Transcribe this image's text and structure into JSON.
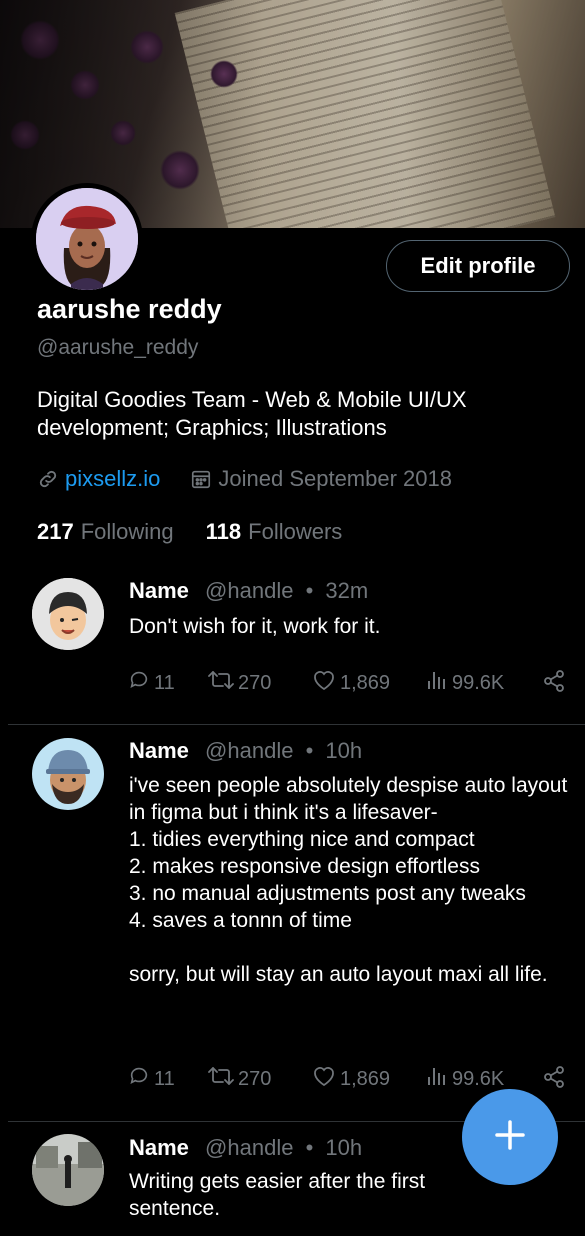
{
  "profile": {
    "name": "aarushe reddy",
    "handle": "@aarushe_reddy",
    "bio": "Digital Goodies Team - Web & Mobile UI/UX development; Graphics; Illustrations",
    "website": "pixsellz.io",
    "joined": "Joined September 2018",
    "following_count": "217",
    "following_label": "Following",
    "followers_count": "118",
    "followers_label": "Followers",
    "edit_label": "Edit profile"
  },
  "tweets": [
    {
      "name": "Name",
      "handle": "@handle",
      "time": "32m",
      "text": "Don't wish for it, work for it.",
      "replies": "11",
      "retweets": "270",
      "likes": "1,869",
      "views": "99.6K"
    },
    {
      "name": "Name",
      "handle": "@handle",
      "time": "10h",
      "text": "i've seen people absolutely despise auto layout in figma but i think it's a lifesaver-\n1. tidies everything nice and compact\n2. makes responsive design effortless\n3. no manual adjustments post any tweaks\n4. saves a tonnn of time\n\nsorry, but will stay an auto layout maxi all life.",
      "replies": "11",
      "retweets": "270",
      "likes": "1,869",
      "views": "99.6K"
    },
    {
      "name": "Name",
      "handle": "@handle",
      "time": "10h",
      "text": "Writing gets easier after the first sentence."
    }
  ],
  "separator": "•",
  "icons": {
    "link": "link-icon",
    "calendar": "calendar-icon",
    "reply": "reply-icon",
    "retweet": "retweet-icon",
    "like": "heart-icon",
    "views": "views-icon",
    "share": "share-icon",
    "compose": "plus-icon"
  },
  "colors": {
    "background": "#000000",
    "accent": "#1d9bf0",
    "fab": "#4a99e9",
    "muted": "#71767b",
    "divider": "#2f3336"
  }
}
